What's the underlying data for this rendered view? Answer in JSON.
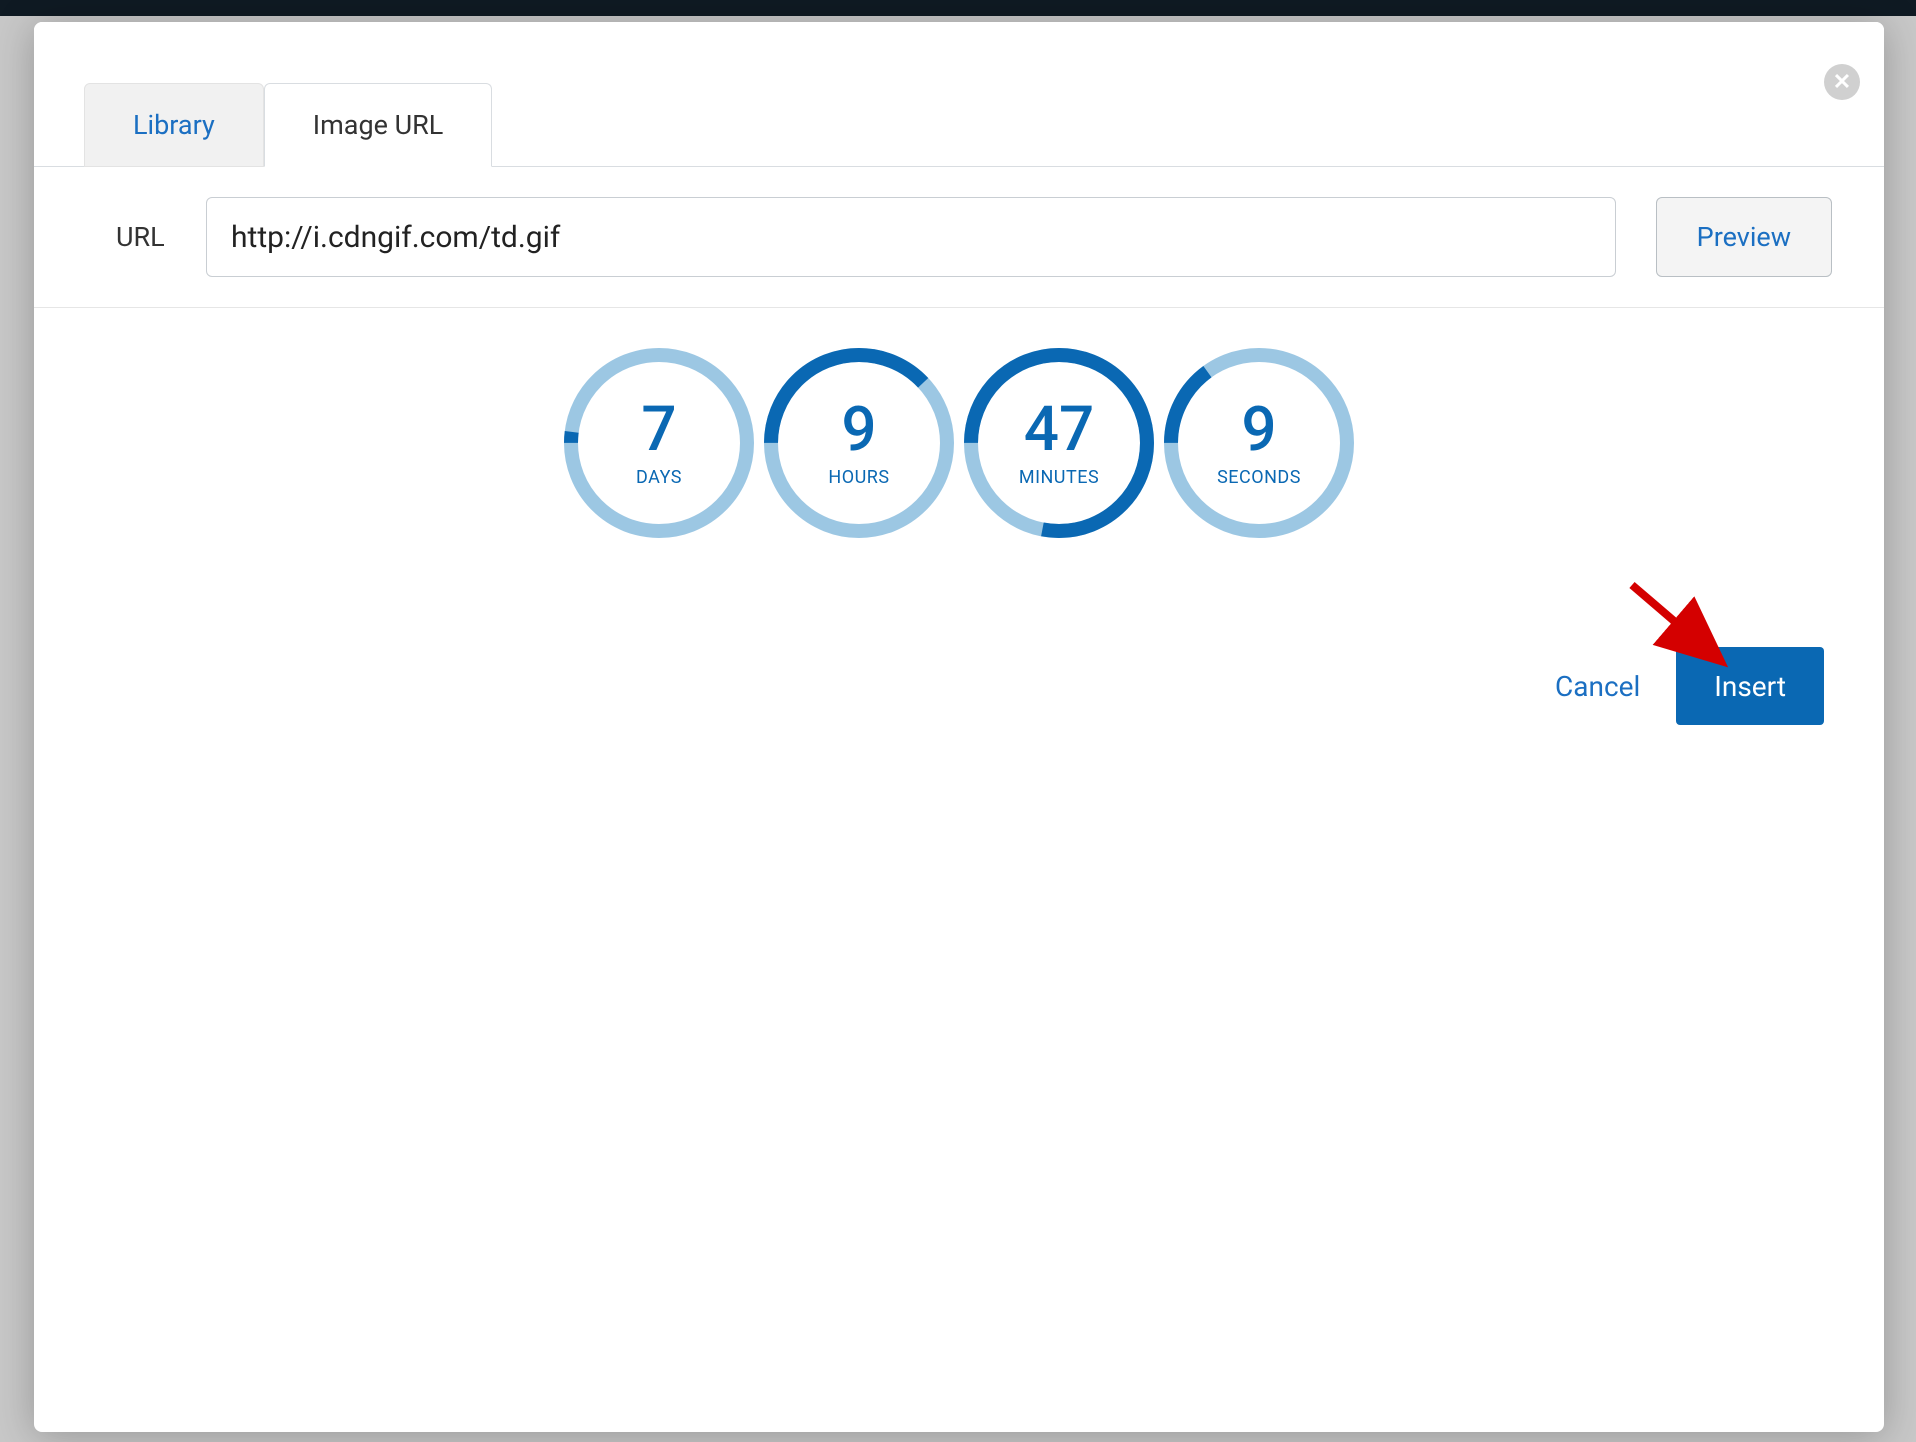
{
  "tabs": {
    "library": "Library",
    "image_url": "Image URL"
  },
  "url_row": {
    "label": "URL",
    "value": "http://i.cdngif.com/td.gif",
    "preview": "Preview"
  },
  "countdown": [
    {
      "value": "7",
      "label": "DAYS",
      "progress": 0.02
    },
    {
      "value": "9",
      "label": "HOURS",
      "progress": 0.38
    },
    {
      "value": "47",
      "label": "MINUTES",
      "progress": 0.78
    },
    {
      "value": "9",
      "label": "SECONDS",
      "progress": 0.15
    }
  ],
  "actions": {
    "cancel": "Cancel",
    "insert": "Insert"
  },
  "colors": {
    "ring_track": "#9cc7e3",
    "ring_progress": "#0a68b3"
  }
}
